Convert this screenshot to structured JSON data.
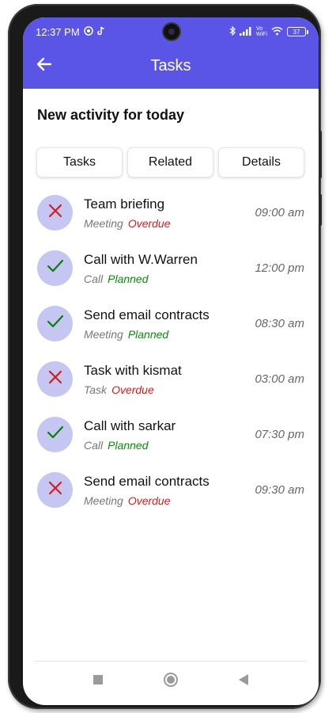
{
  "status_bar": {
    "time": "12:37 PM",
    "battery": "37",
    "vowifi_top": "Vo",
    "vowifi_bottom": "WiFi",
    "icons": [
      "whatsapp-icon",
      "tiktok-icon",
      "bluetooth-icon",
      "signal-icon",
      "wifi-icon",
      "battery-icon"
    ]
  },
  "header": {
    "title": "Tasks",
    "back_icon": "arrow-left-icon",
    "background": "#5a55e6"
  },
  "section_title": "New activity for today",
  "tabs": [
    {
      "label": "Tasks"
    },
    {
      "label": "Related"
    },
    {
      "label": "Details"
    }
  ],
  "tasks": [
    {
      "title": "Team briefing",
      "type": "Meeting",
      "status": "Overdue",
      "time": "09:00 am",
      "icon": "cross-icon"
    },
    {
      "title": "Call with W.Warren",
      "type": "Call",
      "status": "Planned",
      "time": "12:00 pm",
      "icon": "check-icon"
    },
    {
      "title": "Send email contracts",
      "type": "Meeting",
      "status": "Planned",
      "time": "08:30 am",
      "icon": "check-icon"
    },
    {
      "title": "Task with kismat",
      "type": "Task",
      "status": "Overdue",
      "time": "03:00 am",
      "icon": "cross-icon"
    },
    {
      "title": "Call with sarkar",
      "type": "Call",
      "status": "Planned",
      "time": "07:30 pm",
      "icon": "check-icon"
    },
    {
      "title": "Send email contracts",
      "type": "Meeting",
      "status": "Overdue",
      "time": "09:30 am",
      "icon": "cross-icon"
    }
  ],
  "colors": {
    "overdue": "#d81b1b",
    "planned": "#0e8a0e",
    "avatar_bg": "#c5c6f2"
  },
  "nav": [
    "square-icon",
    "circle-icon",
    "triangle-back-icon"
  ]
}
